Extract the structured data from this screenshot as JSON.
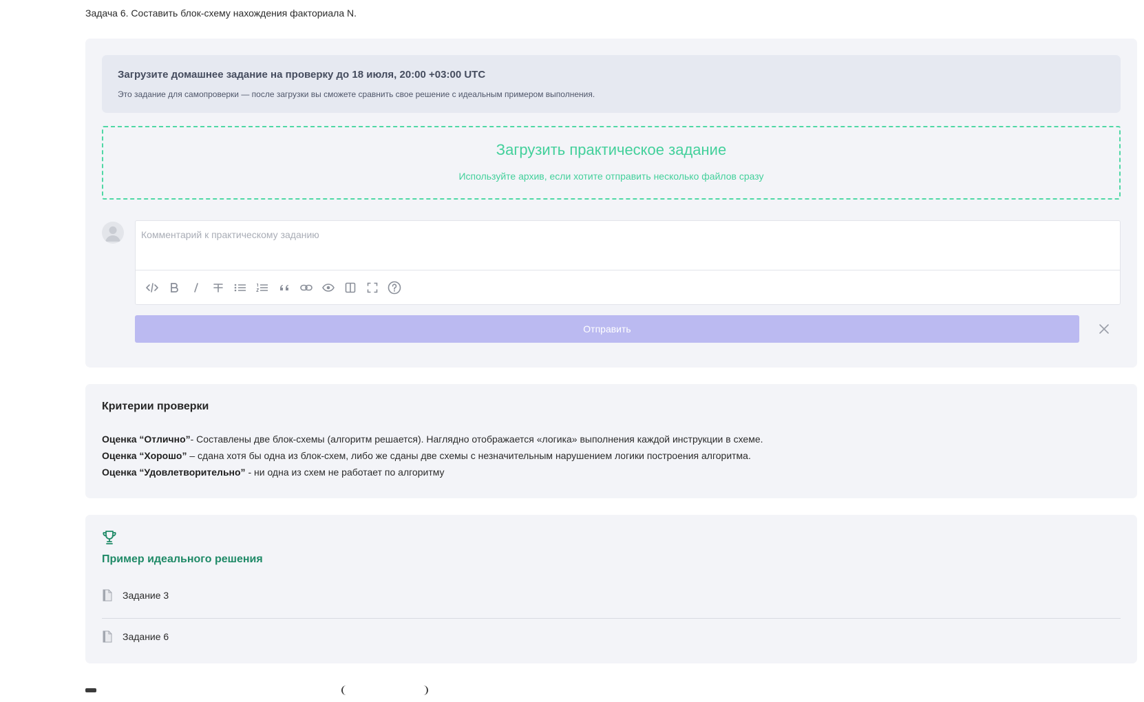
{
  "task": {
    "text": "Задача 6. Составить блок-схему нахождения факториала N."
  },
  "upload": {
    "deadline_title": "Загрузите домашнее задание на проверку до 18 июля, 20:00 +03:00 UTC",
    "deadline_note": "Это задание для самопроверки — после загрузки вы сможете сравнить свое решение с идеальным примером выполнения.",
    "dropzone_title": "Загрузить практическое задание",
    "dropzone_hint": "Используйте архив, если хотите отправить несколько файлов сразу",
    "comment_placeholder": "Комментарий к практическому заданию",
    "submit_label": "Отправить",
    "toolbar": [
      "code-icon",
      "bold-icon",
      "italic-icon",
      "strikethrough-icon",
      "bullet-list-icon",
      "numbered-list-icon",
      "quote-icon",
      "link-icon",
      "preview-icon",
      "side-by-side-icon",
      "fullscreen-icon",
      "help-icon"
    ]
  },
  "criteria": {
    "title": "Критерии проверки",
    "items": [
      {
        "grade": "Оценка “Отлично”",
        "text": "- Составлены две блок-схемы (алгоритм решается). Наглядно отображается «логика» выполнения каждой инструкции в схеме."
      },
      {
        "grade": "Оценка “Хорошо”",
        "text": " – сдана хотя бы одна из блок-схем, либо же сданы две схемы с незначительным нарушением логики построения алгоритма."
      },
      {
        "grade": "Оценка “Удовлетворительно”",
        "text": " -  ни одна из схем не работает по алгоритму"
      }
    ]
  },
  "example": {
    "title": "Пример идеального решения",
    "files": [
      "Задание 3",
      "Задание 6"
    ]
  },
  "colors": {
    "panel_bg": "#f3f4f8",
    "accent_green": "#43d09b",
    "submit_bg": "#bbbaf1",
    "example_title": "#1f8a67"
  }
}
